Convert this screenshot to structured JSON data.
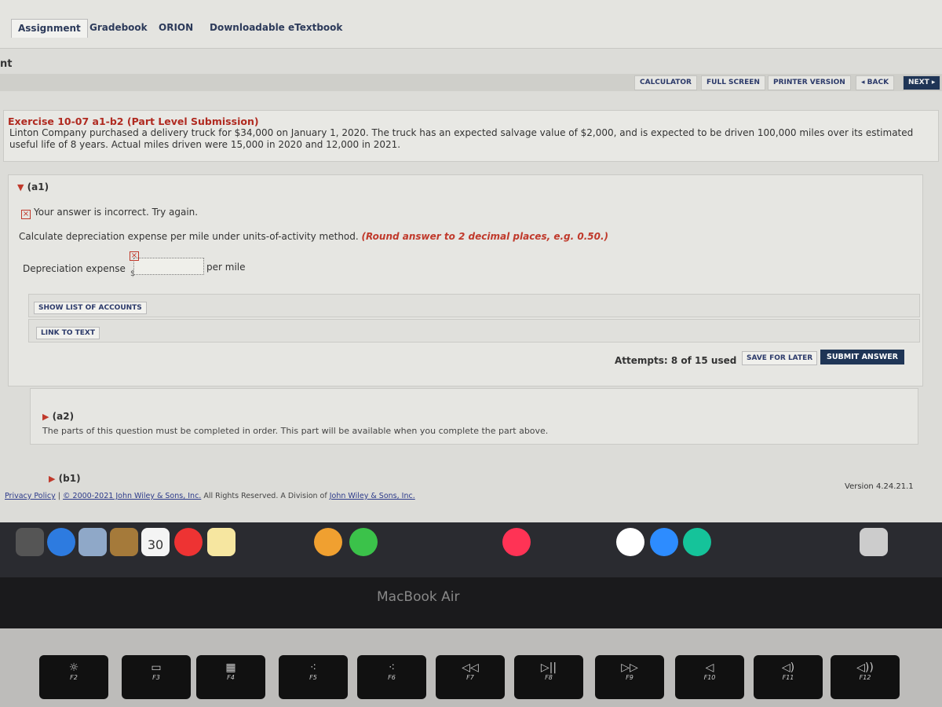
{
  "nav": {
    "tabs": [
      "Assignment",
      "Gradebook",
      "ORION",
      "Downloadable eTextbook"
    ],
    "side_label": "nt"
  },
  "toolbar": {
    "calculator": "CALCULATOR",
    "full_screen": "FULL SCREEN",
    "printer": "PRINTER VERSION",
    "back": "◂ BACK",
    "next": "NEXT ▸"
  },
  "exercise": {
    "title": "Exercise 10-07 a1-b2 (Part Level Submission)",
    "text": "Linton Company purchased a delivery truck for $34,000 on January 1, 2020. The truck has an expected salvage value of $2,000, and is expected to be driven 100,000 miles over its estimated useful life of 8 years. Actual miles driven were 15,000 in 2020 and 12,000 in 2021."
  },
  "a1": {
    "label": "(a1)",
    "error": "Your answer is incorrect.  Try again.",
    "question": "Calculate depreciation expense per mile under units-of-activity method.",
    "hint": "(Round answer to 2 decimal places, e.g. 0.50.)",
    "field_label": "Depreciation expense",
    "currency": "$",
    "value": "",
    "unit": "per mile",
    "show_accounts": "SHOW LIST OF ACCOUNTS",
    "link_text": "LINK TO TEXT",
    "attempts": "Attempts: 8 of 15 used",
    "save": "SAVE FOR LATER",
    "submit": "SUBMIT ANSWER"
  },
  "a2": {
    "label": "(a2)",
    "text": "The parts of this question must be completed in order. This part will be available when you complete the part above."
  },
  "b1": {
    "label": "(b1)"
  },
  "footer": {
    "privacy": "Privacy Policy",
    "sep": "|",
    "copyright": "© 2000-2021 John Wiley & Sons, Inc.",
    "rights": "All Rights Reserved. A Division of",
    "company": "John Wiley & Sons, Inc.",
    "version": "Version 4.24.21.1"
  },
  "device": {
    "label": "MacBook Air",
    "calendar_day": "30",
    "keys": [
      "F2",
      "F3",
      "F4",
      "F5",
      "F6",
      "F7",
      "F8",
      "F9",
      "F10",
      "F11",
      "F12"
    ]
  },
  "colors": {
    "accent": "#1f3556",
    "error": "#c0392b"
  }
}
